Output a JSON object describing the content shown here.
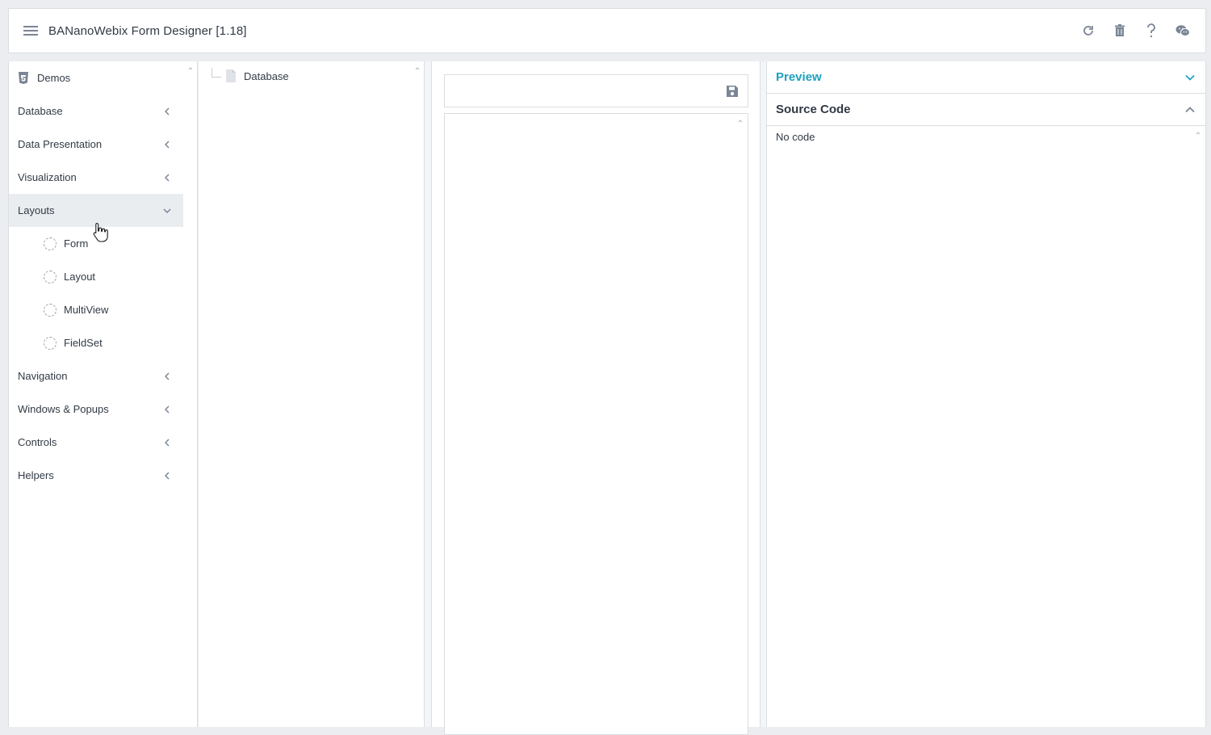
{
  "header": {
    "title": "BANanoWebix Form Designer [1.18]",
    "icons": [
      "refresh-icon",
      "trash-icon",
      "help-icon",
      "wechat-icon"
    ]
  },
  "sidebar": {
    "items": [
      {
        "label": "Demos",
        "icon": "html5-icon"
      },
      {
        "label": "Database",
        "expanded": false
      },
      {
        "label": "Data Presentation",
        "expanded": false
      },
      {
        "label": "Visualization",
        "expanded": false
      },
      {
        "label": "Layouts",
        "expanded": true,
        "children": [
          "Form",
          "Layout",
          "MultiView",
          "FieldSet"
        ]
      },
      {
        "label": "Navigation",
        "expanded": false
      },
      {
        "label": "Windows & Popups",
        "expanded": false
      },
      {
        "label": "Controls",
        "expanded": false
      },
      {
        "label": "Helpers",
        "expanded": false
      }
    ]
  },
  "tree": {
    "root_label": "Database"
  },
  "right_panel": {
    "preview_label": "Preview",
    "source_label": "Source Code",
    "source_text": "No code"
  },
  "colors": {
    "accent": "#1ca1c1",
    "active_bg": "#eaedf0",
    "border": "#dadee0"
  }
}
